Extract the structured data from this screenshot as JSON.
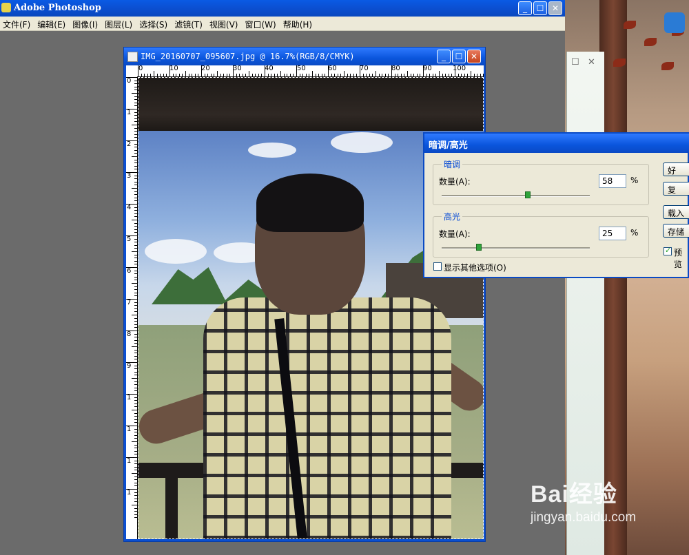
{
  "app": {
    "title": "Adobe Photoshop",
    "menu": [
      "文件(F)",
      "编辑(E)",
      "图像(I)",
      "图层(L)",
      "选择(S)",
      "滤镜(T)",
      "视图(V)",
      "窗口(W)",
      "帮助(H)"
    ]
  },
  "document": {
    "title": "IMG_20160707_095607.jpg @ 16.7%(RGB/8/CMYK)",
    "zoom": "16.7%",
    "ruler_h": [
      "0",
      "10",
      "20",
      "30",
      "40",
      "50",
      "60",
      "70",
      "80",
      "90",
      "100"
    ],
    "ruler_v": [
      "0",
      "1",
      "2",
      "3",
      "4",
      "5",
      "6",
      "7",
      "8",
      "9",
      "1",
      "1",
      "1",
      "1"
    ]
  },
  "dialog": {
    "title": "暗调/高光",
    "shadows": {
      "legend": "暗调",
      "amount_label": "数量(A):",
      "value": "58",
      "unit": "%",
      "slider_fraction": 0.58
    },
    "highlights": {
      "legend": "高光",
      "amount_label": "数量(A):",
      "value": "25",
      "unit": "%",
      "slider_fraction": 0.25
    },
    "more_options_label": "显示其他选项(O)",
    "more_options_checked": false,
    "buttons": {
      "ok": "好",
      "reset": "复",
      "load": "载入",
      "save": "存储"
    },
    "preview_label": "预览",
    "preview_checked": true
  },
  "watermark": {
    "brand": "Bai经验",
    "url": "jingyan.baidu.com"
  }
}
